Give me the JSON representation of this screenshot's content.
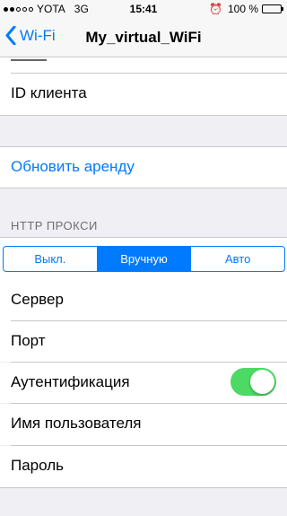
{
  "status_bar": {
    "carrier": "YOTA",
    "network": "3G",
    "time": "15:41",
    "battery": "100 %",
    "signal_bars_filled": 2,
    "signal_bars_total": 5
  },
  "nav": {
    "back_label": "Wi-Fi",
    "title": "My_virtual_WiFi"
  },
  "cells": {
    "client_id": "ID клиента",
    "renew_lease": "Обновить аренду"
  },
  "proxy": {
    "section_header": "HTTP ПРОКСИ",
    "segments": [
      "Выкл.",
      "Вручную",
      "Авто"
    ],
    "selected_segment": "Вручную",
    "server": "Сервер",
    "port": "Порт",
    "auth": "Аутентификация",
    "auth_enabled": true,
    "username": "Имя пользователя",
    "password": "Пароль"
  },
  "colors": {
    "accent": "#007aff",
    "toggle_on": "#4cd964",
    "background": "#efeff4"
  }
}
